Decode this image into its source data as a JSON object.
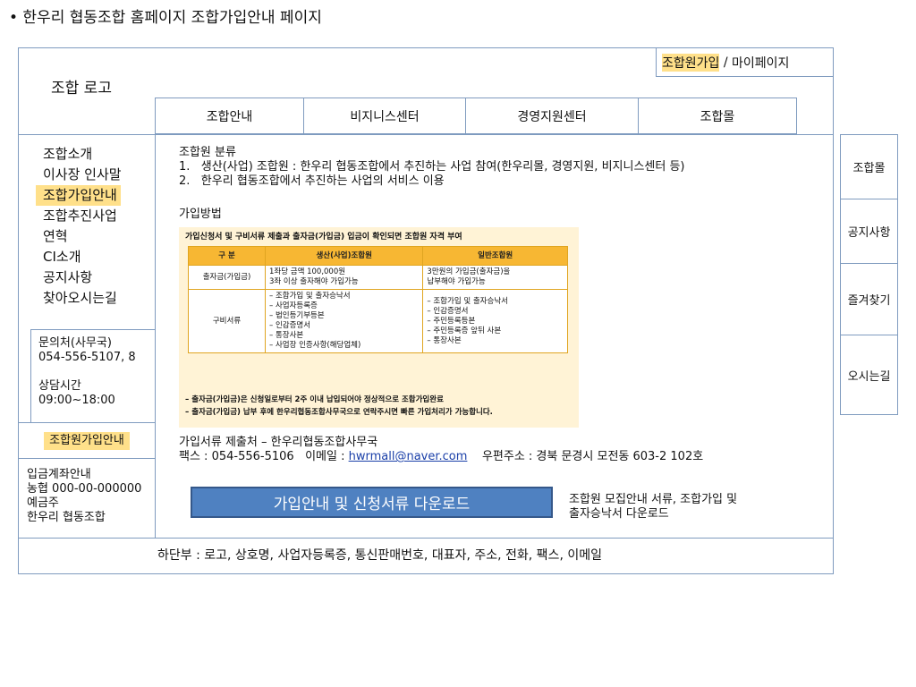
{
  "page_title": "• 한우리 협동조합 홈페이지 조합가입안내 페이지",
  "header": {
    "logo": "조합 로고",
    "top_links": {
      "join": "조합원가입",
      "separator": " / ",
      "mypage": "마이페이지"
    },
    "nav": [
      "조합안내",
      "비지니스센터",
      "경영지원센터",
      "조합몰"
    ]
  },
  "sidebar": {
    "menu": [
      "조합소개",
      "이사장 인사말",
      "조합가입안내",
      "조합추진사업",
      "연혁",
      "CI소개",
      "공지사항",
      "찾아오시는길"
    ],
    "active_index": 2,
    "contact": {
      "label": "문의처(사무국)",
      "phone": "054-556-5107, 8",
      "hours_label": "상담시간",
      "hours": "09:00~18:00"
    },
    "join_guide_button": "조합원가입안내",
    "account": {
      "title": "입금계좌안내",
      "bank": "농협 000-00-000000",
      "holder_label": "예금주",
      "holder": "한우리 협동조합"
    }
  },
  "right_sidebar": [
    "조합몰",
    "공지사항",
    "즐겨찾기",
    "오시는길"
  ],
  "main": {
    "classification_title": "조합원 분류",
    "classification_items": [
      "1.   생산(사업) 조합원 : 한우리 협동조합에서 추진하는 사업 참여(한우리몰, 경영지원, 비지니스센터 등)",
      "2.   한우리 협동조합에서 추진하는 사업의 서비스 이용"
    ],
    "method_title": "가입방법",
    "table_image": {
      "caption": "가입신청서 및 구비서류 제출과 출자금(가입금) 입금이 확인되면 조합원 자격 부여",
      "headers": [
        "구 분",
        "생산(사업)조합원",
        "일반조합원"
      ],
      "rows": [
        {
          "category": "출자금(가입금)",
          "production": [
            "1좌당 금액 100,000원",
            "3좌 이상 출자해야 가입가능"
          ],
          "general": [
            "3만원의 가입금(출자금)을",
            "납부해야 가입가능"
          ]
        },
        {
          "category": "구비서류",
          "production": [
            "– 조합가입 및 출자승낙서",
            "– 사업자등록증",
            "– 법인등기부등본",
            "– 인감증명서",
            "– 통장사본",
            "– 사업장 인증사항(해당업체)"
          ],
          "general": [
            "– 조합가입 및 출자승낙서",
            "– 인감증명서",
            "– 주민등록등본",
            "– 주민등록증 앞뒤 사본",
            "– 통장사본"
          ]
        }
      ],
      "notes": [
        "– 출자금(가입금)은 신청일로부터 2주 이내 납입되어야 정상적으로 조합가입완료",
        "– 출자금(가입금) 납부 후에 한우리협동조합사무국으로 연락주시면 빠른 가입처리가 가능합니다."
      ]
    },
    "submission": {
      "line1": "가입서류 제출처 – 한우리협동조합사무국",
      "fax": "팩스 : 054-556-5106",
      "email_label": "이메일 : ",
      "email": "hwrmall@naver.com",
      "postal": "우편주소 : 경북 문경시 모전동 603-2 102호"
    },
    "download_button": "가입안내 및 신청서류 다운로드",
    "download_desc": [
      "조합원 모집안내 서류, 조합가입 및",
      "출자승낙서 다운로드"
    ]
  },
  "footer": "하단부 : 로고, 상호명, 사업자등록증, 통신판매번호, 대표자, 주소, 전화, 팩스, 이메일"
}
